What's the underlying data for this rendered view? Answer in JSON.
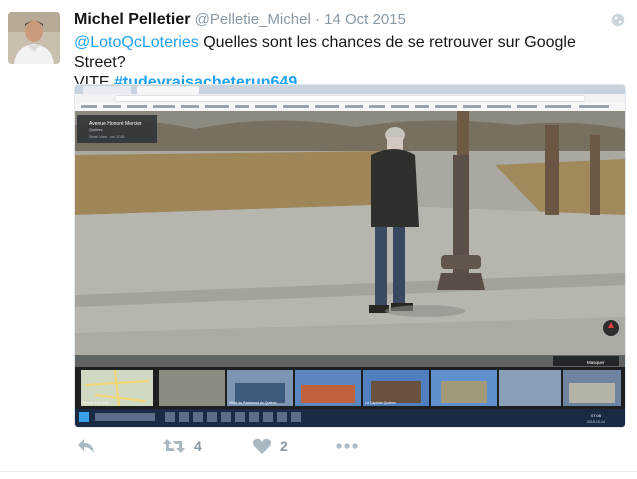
{
  "tweet": {
    "display_name": "Michel Pelletier",
    "handle": "@Pelletie_Michel",
    "separator": "·",
    "date": "14 Oct 2015",
    "mention": "@LotoQcLoteries",
    "text_part1": " Quelles sont les chances de se retrouver sur Google Street?",
    "text_part2": "VITE ",
    "hashtag": "#tudevraisacheterun649"
  },
  "screenshot": {
    "map_title": "Avenue Honoré Mercier",
    "map_subtitle": "Québec",
    "map_meta": "Street View - oct. 2015",
    "photo_label": "Masquer",
    "thumb_label_1": "Retour à la carte",
    "thumb_label_2": "Hôtel du Parlement du Québec",
    "thumb_label_3": "La Capitale Québec",
    "taskbar_time": "07:08",
    "taskbar_date": "2015-10-14"
  },
  "actions": {
    "retweet_count": "4",
    "like_count": "2"
  },
  "colors": {
    "link": "#1da1f2",
    "muted": "#8899a6",
    "icon": "#aab8c2"
  }
}
